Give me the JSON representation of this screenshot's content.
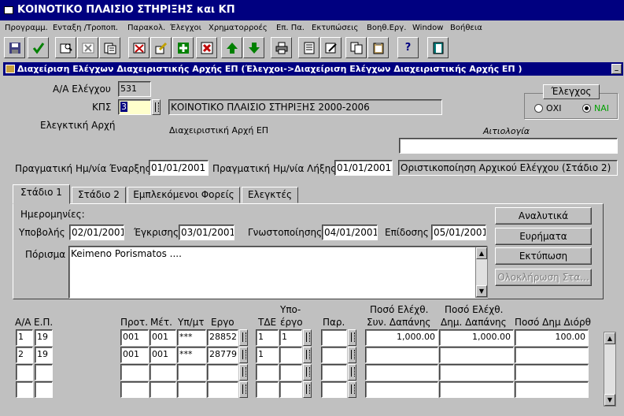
{
  "window_title": "ΚΟΙΝΟΤΙΚΟ ΠΛΑΙΣΙΟ ΣΤΗΡΙΞΗΣ και ΚΠ",
  "menu": [
    "Προγραμμ.",
    "Ενταξη /Τροποπ.",
    "Παρακολ.",
    "Έλεγχοι",
    "Χρηματορροές",
    "Επ. Πα.",
    "Εκτυπώσεις",
    "Βοηθ.Εργ.",
    "Window",
    "Βοήθεια"
  ],
  "toolbar": {
    "help_label": "?"
  },
  "form_title": "Διαχείριση Ελέγχων Διαχειριστικής Αρχής ΕΠ (Έλεγχοι->Διαχείριση Ελέγχων Διαχειριστικής Αρχής ΕΠ )",
  "form": {
    "aa_label": "Α/Α Ελέγχου",
    "aa_value": "531",
    "kps_label": "ΚΠΣ",
    "kps_code": "3",
    "kps_desc": "ΚΟΙΝΟΤΙΚΟ ΠΛΑΙΣΙΟ ΣΤΗΡΙΞΗΣ 2000-2006",
    "auditor_label": "Ελεγκτική Αρχή",
    "managing_label": "Διαχειριστική Αρχή ΕΠ",
    "reason_label": "Αιτιολογία",
    "reason_value": "",
    "start_label": "Πραγματική Ημ/νία Έναρξης",
    "start_value": "01/01/2001",
    "end_label": "Πραγματική Ημ/νία Λήξης",
    "end_value": "01/01/2001",
    "status_value": "Οριστικοποίηση Αρχικού Ελέγχου (Στάδιο 2)",
    "check_group_label": "Έλεγχος",
    "radio_no": "ΟΧΙ",
    "radio_yes": "ΝΑΙ"
  },
  "tabs": [
    "Στάδιο 1",
    "Στάδιο 2",
    "Εμπλεκόμενοι Φορείς",
    "Ελεγκτές"
  ],
  "stage1": {
    "dates_label": "Ημερομηνίες:",
    "submit_label": "Υποβολής",
    "submit_value": "02/01/2001",
    "approval_label": "Έγκρισης",
    "approval_value": "03/01/2001",
    "notify_label": "Γνωστοποίησης",
    "notify_value": "04/01/2001",
    "delivery_label": "Επίδοσης",
    "delivery_value": "05/01/2001",
    "finding_label": "Πόρισμα",
    "finding_value": "Keimeno Porismatos ....",
    "buttons": {
      "analytics": "Αναλυτικά",
      "findings": "Ευρήματα",
      "print": "Εκτύπωση",
      "complete": "Ολοκλήρωση Στα..."
    }
  },
  "grid": {
    "headers": {
      "aa": "Α/Α",
      "ep": "Ε.Π.",
      "prot": "Προτ.",
      "met": "Μέτ.",
      "ypmt": "Υπ/μτ",
      "ergo": "Εργο",
      "tde": "ΤΔΕ",
      "ypoergo_top": "Υπο-",
      "ypoergo_bottom": "έργο",
      "par": "Παρ.",
      "poso1_top": "Ποσό Ελέχθ.",
      "poso1_bottom": "Συν. Δαπάνης",
      "poso2_top": "Ποσό Ελέχθ.",
      "poso2_bottom": "Δημ. Δαπάνης",
      "poso3": "Ποσό Δημ Διόρθ"
    },
    "rows": [
      {
        "aa": "1",
        "ep": "19",
        "prot": "001",
        "met": "001",
        "ypmt": "***",
        "ergo": "28852",
        "tde": "1",
        "ypoergo": "1",
        "par": "",
        "poso1": "1,000.00",
        "poso2": "1,000.00",
        "poso3": "100.00"
      },
      {
        "aa": "2",
        "ep": "19",
        "prot": "001",
        "met": "001",
        "ypmt": "***",
        "ergo": "28779",
        "tde": "1",
        "ypoergo": "",
        "par": "",
        "poso1": "",
        "poso2": "",
        "poso3": ""
      },
      {
        "aa": "",
        "ep": "",
        "prot": "",
        "met": "",
        "ypmt": "",
        "ergo": "",
        "tde": "",
        "ypoergo": "",
        "par": "",
        "poso1": "",
        "poso2": "",
        "poso3": ""
      },
      {
        "aa": "",
        "ep": "",
        "prot": "",
        "met": "",
        "ypmt": "",
        "ergo": "",
        "tde": "",
        "ypoergo": "",
        "par": "",
        "poso1": "",
        "poso2": "",
        "poso3": ""
      }
    ]
  },
  "colors": {
    "title_bar": "#000080",
    "face": "#c0c0c0",
    "active_field": "#ffffcc"
  }
}
